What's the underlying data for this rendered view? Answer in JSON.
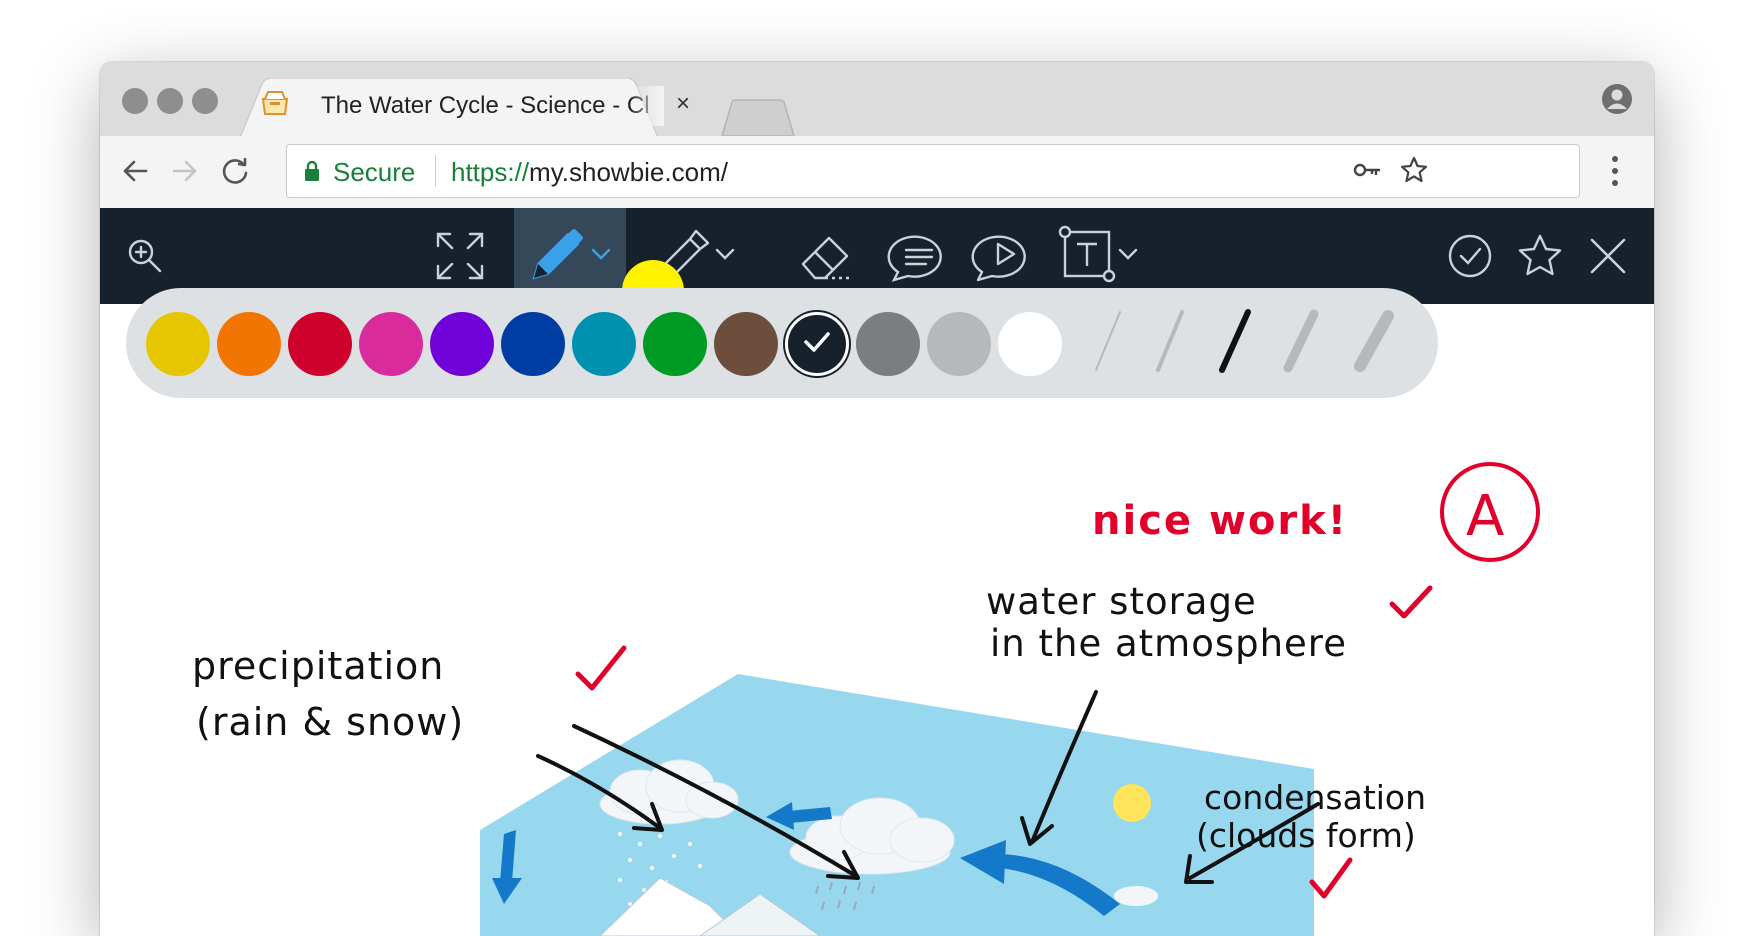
{
  "browser": {
    "tab_title": "The Water Cycle - Science - Cl",
    "tab_close": "×",
    "secure_label": "Secure",
    "url_scheme": "https://",
    "url_host": "my.showbie.com/"
  },
  "toolbar": {
    "icons": [
      "zoom-in-icon",
      "fullscreen-icon",
      "pen-icon",
      "highlighter-icon",
      "eraser-icon",
      "comment-icon",
      "voice-note-icon",
      "text-box-icon",
      "checkmark-icon",
      "star-icon",
      "close-icon"
    ],
    "active_tool": "pen-icon"
  },
  "palette": {
    "colors": [
      "#e6c600",
      "#f17500",
      "#d0002c",
      "#d92b9c",
      "#7001d8",
      "#003da2",
      "#0091b0",
      "#009b24",
      "#6d4e3c",
      "#17212b",
      "#7b7d7f",
      "#b6b9bb",
      "#ffffff"
    ],
    "selected_color": "#17212b",
    "stroke_widths": [
      "extra-thin",
      "thin",
      "medium",
      "thick",
      "extra-thick"
    ],
    "selected_stroke": "medium"
  },
  "annotations": {
    "nice_work": "nice work!",
    "grade": "A",
    "water_storage_1": "water storage",
    "water_storage_2": "in the atmosphere",
    "precipitation_1": "precipitation",
    "precipitation_2": "(rain & snow)",
    "condensation_1": "condensation",
    "condensation_2": "(clouds form)",
    "check_mark": "✓"
  },
  "colors": {
    "ink_red": "#e0002a",
    "ink_black": "#111111",
    "sky": "#98d8ee",
    "arrow_blue": "#1479c9",
    "sun": "#ffe45c"
  }
}
